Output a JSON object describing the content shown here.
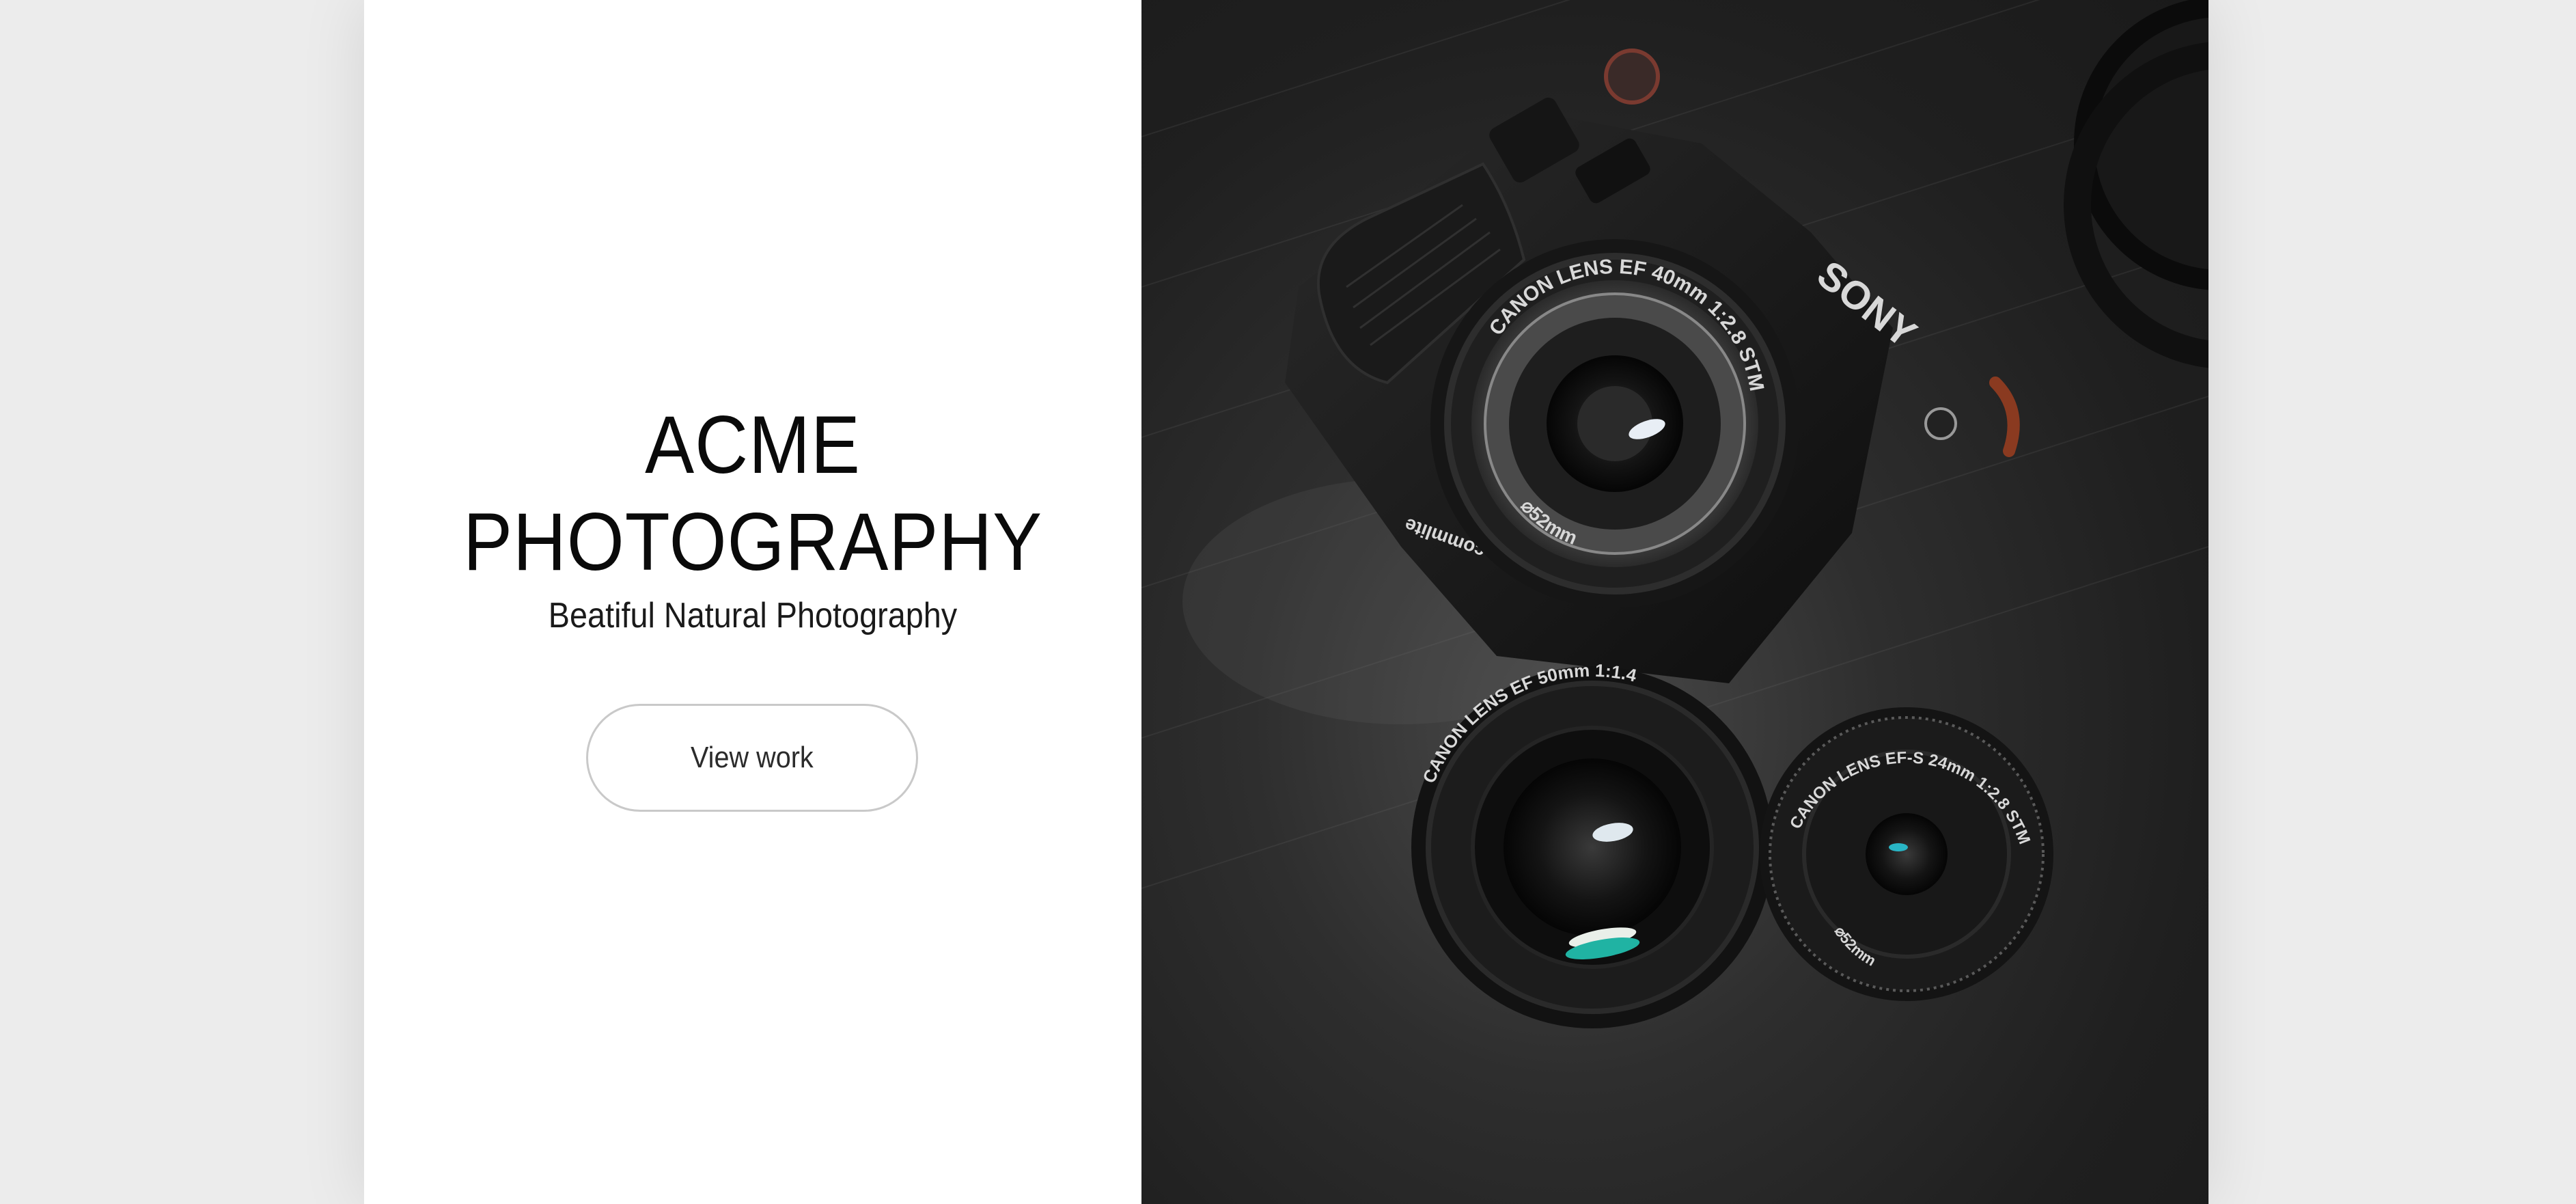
{
  "hero": {
    "title_line1": "ACME",
    "title_line2": "PHOTOGRAPHY",
    "tagline": "Beatiful Natural Photography",
    "cta_label": "View work"
  },
  "photo": {
    "camera_brand": "SONY",
    "main_lens_text": "CANON LENS EF 40mm 1:2.8 STM",
    "main_lens_filter": "⌀52mm",
    "lens_50_text": "CANON LENS EF 50mm 1:1.4",
    "lens_24_text": "CANON LENS EF-S 24mm 1:2.8 STM",
    "lens_24_filter": "⌀52mm",
    "adapter_brand": "commlite"
  },
  "colors": {
    "page_background": "#ececec",
    "panel_background": "#ffffff",
    "text": "#0a0a0a",
    "button_border": "#c9c9c9",
    "photo_dark": "#1f1f1f"
  }
}
